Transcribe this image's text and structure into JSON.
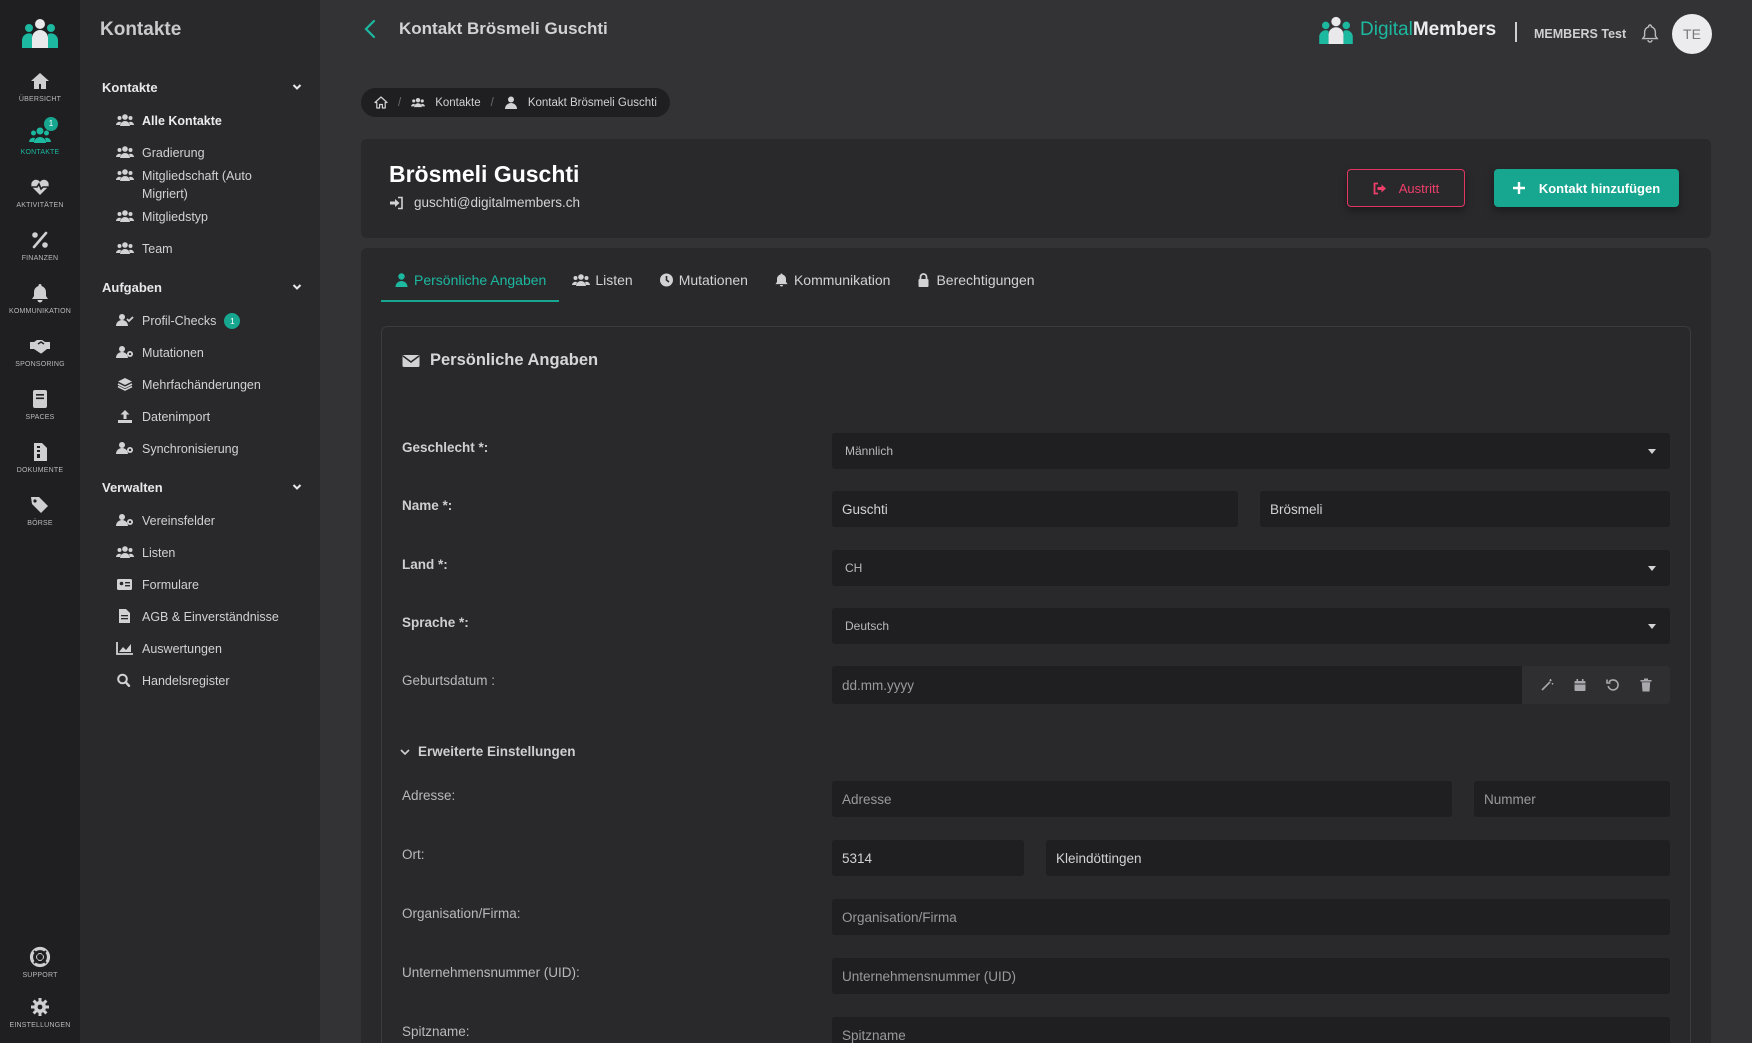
{
  "rail": {
    "items": [
      {
        "label": "Übersicht",
        "icon": "home-icon"
      },
      {
        "label": "Kontakte",
        "icon": "users-icon",
        "badge": "1"
      },
      {
        "label": "Aktivitäten",
        "icon": "heartbeat-icon"
      },
      {
        "label": "Finanzen",
        "icon": "percent-icon"
      },
      {
        "label": "Kommunikation",
        "icon": "bell-icon"
      },
      {
        "label": "Sponsoring",
        "icon": "handshake-icon"
      },
      {
        "label": "Spaces",
        "icon": "book-icon"
      },
      {
        "label": "Dokumente",
        "icon": "file-icon"
      },
      {
        "label": "Börse",
        "icon": "tags-icon"
      },
      {
        "label": "Support",
        "icon": "lifebuoy-icon"
      },
      {
        "label": "Einstellungen",
        "icon": "gear-icon"
      }
    ]
  },
  "sidebar": {
    "title": "Kontakte",
    "sections": [
      {
        "title": "Kontakte",
        "items": [
          "Alle Kontakte",
          "Gradierung",
          "Mitgliedschaft (Auto Migriert)",
          "Mitgliedstyp",
          "Team"
        ]
      },
      {
        "title": "Aufgaben",
        "items": [
          "Profil-Checks",
          "Mutationen",
          "Mehrfachänderungen",
          "Datenimport",
          "Synchronisierung"
        ],
        "badge": "1"
      },
      {
        "title": "Verwalten",
        "items": [
          "Vereinsfelder",
          "Listen",
          "Formulare",
          "AGB & Einverständnisse",
          "Auswertungen",
          "Handelsregister"
        ]
      }
    ]
  },
  "topbar": {
    "page_title": "Kontakt Brösmeli Guschti",
    "brand_digital": "Digital",
    "brand_members": "Members",
    "org_name": "MEMBERS Test",
    "avatar_initials": "TE"
  },
  "breadcrumb": {
    "items": [
      "Kontakte",
      "Kontakt Brösmeli Guschti"
    ]
  },
  "contact": {
    "name": "Brösmeli Guschti",
    "email": "guschti@digitalmembers.ch",
    "btn_austritt": "Austritt",
    "btn_add": "Kontakt hinzufügen"
  },
  "tabs": [
    {
      "label": "Persönliche Angaben",
      "icon": "user-icon",
      "active": true
    },
    {
      "label": "Listen",
      "icon": "users-icon"
    },
    {
      "label": "Mutationen",
      "icon": "clock-icon"
    },
    {
      "label": "Kommunikation",
      "icon": "bell-icon"
    },
    {
      "label": "Berechtigungen",
      "icon": "lock-icon"
    }
  ],
  "form": {
    "section_title": "Persönliche Angaben",
    "gender_label": "Geschlecht *:",
    "gender_value": "Männlich",
    "name_label": "Name *:",
    "first_name": "Guschti",
    "last_name": "Brösmeli",
    "country_label": "Land *:",
    "country_value": "CH",
    "language_label": "Sprache *:",
    "language_value": "Deutsch",
    "birthdate_label": "Geburtsdatum :",
    "birthdate_placeholder": "dd.mm.yyyy",
    "advanced_label": "Erweiterte Einstellungen",
    "address_label": "Adresse:",
    "address_placeholder": "Adresse",
    "number_placeholder": "Nummer",
    "city_label": "Ort:",
    "zip": "5314",
    "city": "Kleindöttingen",
    "org_label": "Organisation/Firma:",
    "org_placeholder": "Organisation/Firma",
    "uid_label": "Unternehmensnummer (UID):",
    "uid_placeholder": "Unternehmensnummer (UID)",
    "nickname_label": "Spitzname:",
    "nickname_placeholder": "Spitzname"
  },
  "colors": {
    "accent": "#17a68f",
    "danger": "#e0365f",
    "background": "#333336",
    "rail": "#1f1f21",
    "sidebar": "#29292c"
  }
}
